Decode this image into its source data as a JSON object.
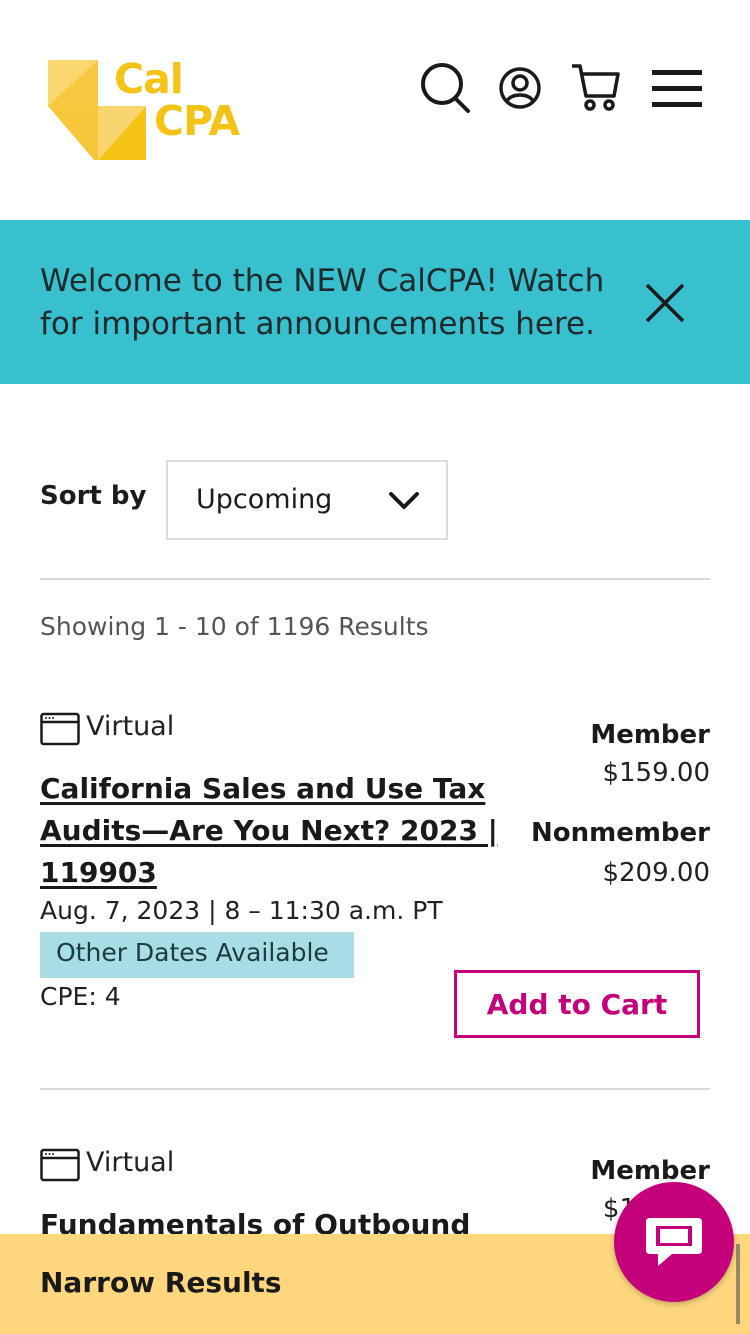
{
  "header": {
    "logo_line1": "Cal",
    "logo_line2": "CPA",
    "icons": [
      "search-icon",
      "user-account-icon",
      "cart-icon",
      "hamburger-menu-icon"
    ]
  },
  "announcement": {
    "text": "Welcome to the NEW CalCPA! Watch for important announcements here.",
    "close_icon": "close-icon"
  },
  "sort": {
    "label": "Sort by",
    "selected": "Upcoming"
  },
  "results_text": "Showing 1 - 10 of 1196 Results",
  "courses": [
    {
      "format": "Virtual",
      "title": "California Sales and Use Tax Audits—Are You Next? 2023 | 119903",
      "date": "Aug. 7, 2023 | 8 – 11:30 a.m. PT",
      "other_dates": "Other Dates Available",
      "cpe": "CPE: 4",
      "member_label": "Member",
      "member_price": "$159.00",
      "nonmember_label": "Nonmember",
      "nonmember_price": "$209.00",
      "cta": "Add to Cart"
    },
    {
      "format": "Virtual",
      "title": "Fundamentals of Outbound",
      "member_label": "Member",
      "member_price": "$1"
    }
  ],
  "narrow_results": {
    "label": "Narrow Results"
  },
  "colors": {
    "brand_yellow": "#f5c315",
    "announce_bg": "#39c0cf",
    "accent_magenta": "#c4007a",
    "narrow_bg": "#fdd67e",
    "badge_bg": "#a7dde5"
  }
}
